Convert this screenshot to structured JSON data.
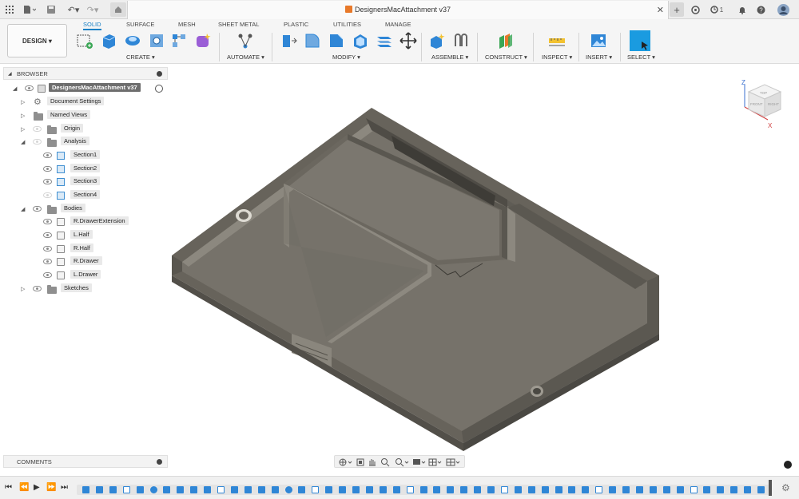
{
  "window": {
    "document_title": "DesignersMacAttachment v37",
    "job_count": "1"
  },
  "toolbar": {
    "workspace": "DESIGN",
    "workspace_tabs": [
      "SOLID",
      "SURFACE",
      "MESH",
      "SHEET METAL",
      "PLASTIC",
      "UTILITIES",
      "MANAGE"
    ],
    "active_tab": "SOLID",
    "groups": [
      "CREATE",
      "AUTOMATE",
      "MODIFY",
      "ASSEMBLE",
      "CONSTRUCT",
      "INSPECT",
      "INSERT",
      "SELECT"
    ]
  },
  "browser": {
    "header": "BROWSER",
    "root": "DesignersMacAttachment v37",
    "items": [
      {
        "label": "Document Settings"
      },
      {
        "label": "Named Views"
      },
      {
        "label": "Origin"
      },
      {
        "label": "Analysis"
      },
      {
        "label": "Section1"
      },
      {
        "label": "Section2"
      },
      {
        "label": "Section3"
      },
      {
        "label": "Section4"
      },
      {
        "label": "Bodies"
      },
      {
        "label": "R.DrawerExtension"
      },
      {
        "label": "L.Half"
      },
      {
        "label": "R.Half"
      },
      {
        "label": "R.Drawer"
      },
      {
        "label": "L.Drawer"
      },
      {
        "label": "Sketches"
      }
    ]
  },
  "comments": {
    "header": "COMMENTS"
  },
  "viewcube": {
    "axis_z": "Z",
    "axis_x": "X",
    "face_top": "TOP",
    "face_front": "FRONT",
    "face_right": "RIGHT"
  },
  "colors": {
    "accent": "#1a80c5",
    "model_face": "#6f6b63",
    "model_dark": "#55524b",
    "model_light": "#8a867d",
    "timeline_feature": "#2f86d6"
  }
}
